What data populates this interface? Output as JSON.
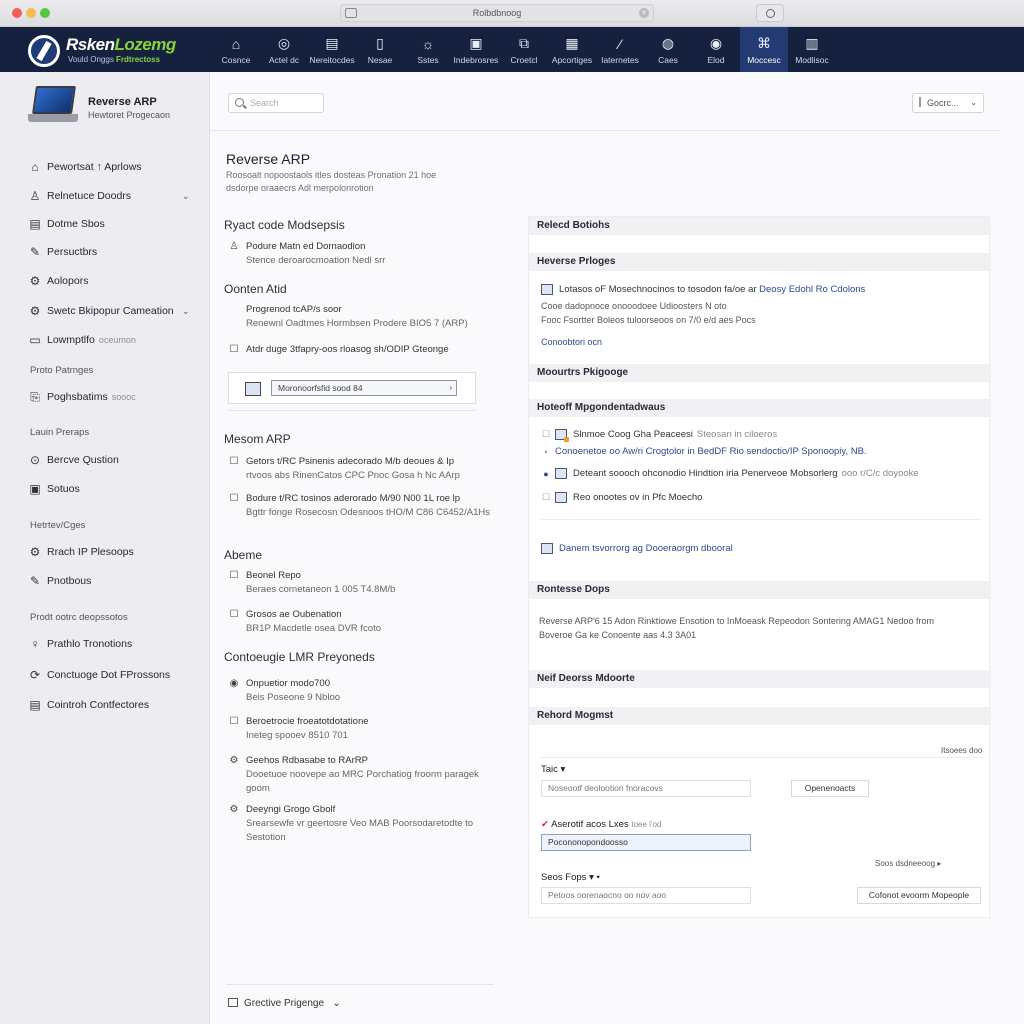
{
  "window": {
    "url": "Rolbdbnoog"
  },
  "brand": {
    "name_main": "Rsken",
    "name_accent": "Lozemg",
    "tagline_main": "Vould Onggs",
    "tagline_accent": "Frdtrectoss"
  },
  "nav": {
    "items": [
      {
        "label": "Cosnce",
        "icon": "⌂"
      },
      {
        "label": "Actel dc",
        "icon": "◎"
      },
      {
        "label": "Nereitocdes",
        "icon": "▤"
      },
      {
        "label": "Nesae",
        "icon": "▯"
      },
      {
        "label": "Sstes",
        "icon": "☼"
      },
      {
        "label": "Indebrosres",
        "icon": "▣"
      },
      {
        "label": "Croetcl",
        "icon": "⧉"
      },
      {
        "label": "Apcortiges",
        "icon": "▦"
      },
      {
        "label": "Iaternetes",
        "icon": "⁄"
      },
      {
        "label": "Caes",
        "icon": "◍"
      },
      {
        "label": "Elod",
        "icon": "◉"
      },
      {
        "label": "Moccesc",
        "icon": "⌘"
      },
      {
        "label": "Modlisoc",
        "icon": "▥"
      }
    ],
    "active_index": 11
  },
  "sidebar": {
    "product_title": "Reverse ARP",
    "product_subtitle": "Hewtoret Progecaon",
    "items": [
      {
        "label": "Pewortsat ↑ Aprlows",
        "icon": "⌂",
        "chevron": false
      },
      {
        "label": "Relnetuce Doodrs",
        "icon": "♙",
        "chevron": true
      },
      {
        "label": "Dotme Sbos",
        "icon": "▤",
        "chevron": false
      },
      {
        "label": "Persuctbrs",
        "icon": "✎",
        "chevron": false
      },
      {
        "label": "Aolopors",
        "icon": "⚙",
        "chevron": false
      },
      {
        "label": "Swetc Bkipopur Cameation",
        "icon": "⚙",
        "chevron": true
      },
      {
        "label": "Lowmptlfo",
        "icon": "▭",
        "chevron": false,
        "muted": "oceumon"
      }
    ],
    "head1": "Proto Patrnges",
    "item_after_head1": {
      "label": "Poghsbatims",
      "icon": "⎘",
      "muted": "soooc"
    },
    "head2": "Lauin Preraps",
    "group2": [
      {
        "label": "Bercve Qustion",
        "icon": "⊙"
      },
      {
        "label": "Sotuos",
        "icon": "▣"
      }
    ],
    "head3": "Hetrtev/Cges",
    "group3": [
      {
        "label": "Rrach IP Plesoops",
        "icon": "⚙"
      },
      {
        "label": "Pnotbous",
        "icon": "✎"
      }
    ],
    "head4": "Prodt ootrc deopssotos",
    "group4": [
      {
        "label": "Prathlo Tronotions",
        "icon": "♀"
      },
      {
        "label": "Conctuoge Dot FProssons",
        "icon": "⟳"
      },
      {
        "label": "Cointroh Contfectores",
        "icon": "▤"
      }
    ]
  },
  "main": {
    "search_placeholder": "Search",
    "select_value": "Gocrc...",
    "title": "Reverse ARP",
    "description": "Roosoalt nopoostaols itles dosteas Pronation 21 hoe dsdorpe oraaecrs Adl merpolonrotion",
    "sec1_title": "Ryact code Modsepsis",
    "sec1_rows": [
      {
        "line1": "Podure Matn ed Dornaodion",
        "line2": "Stence deroarocmoation Nedl srr"
      }
    ],
    "sec2_title": "Oonten Atid",
    "sec2_rows": [
      {
        "line1": "Progrenod tcAP/s soor",
        "line2": "Renewnl Oadtmes Hormbsen Prodere BIO5 7 (ARP)"
      },
      {
        "line1": "Atdr duge 3tfapry-oos rloasog sh/ODIP Gteonge",
        "line2": ""
      }
    ],
    "input_value": "Moronoorfsfid sood 84",
    "sec3_title": "Mesom ARP",
    "sec3_rows": [
      {
        "line1": "Getors t/RC Psinenis adecorado M/b deoues & Ip",
        "line2": "rtvoos abs RinenCatos CPC Pnoc Gosa h Nc AArp"
      },
      {
        "line1": "Bodure t/RC tosinos aderorado M/90 N00 1L roe lp",
        "line2": "Bgttr fonge Rosecosn Odesnoos tHO/M C86 C6452/A1Hs"
      }
    ],
    "sec4_title": "Abeme",
    "sec4_rows": [
      {
        "line1": "Beonel Repo",
        "line2": "Beraes cornetaneon 1 005 T4.8M/b"
      },
      {
        "line1": "Grosos ae Oubenation",
        "line2": "BR1P Macdetle osea DVR fcoto"
      }
    ],
    "sec5_title": "Contoeugie LMR Preyoneds",
    "sec5_rows": [
      {
        "line1": "Onpuetior modo700",
        "line2": "Beis Poseone 9 Nbloo"
      },
      {
        "line1": "Beroetrocie froeatotdotatione",
        "line2": "Ineteg spooev 8510 701"
      },
      {
        "line1": "Geehos Rdbasabe to RArRP",
        "line2": "Dooetuoe noovepe ao MRC Porchatiog froorm paragek",
        "line3": "goom"
      },
      {
        "line1": "Deeyngi Grogo Gbolf",
        "line2": "Srearsewfe vr geertosre Veo MAB Poorsodaretodte to",
        "line3": "Sestotion"
      }
    ],
    "bottom_item": "Grective Prigenge"
  },
  "rpanel": {
    "h1": "Relecd Botiohs",
    "h2": "Heverse Prloges",
    "h2_line1_a": "Lotasos oF Mosechnocinos to tosodon fa/oe ar",
    "h2_line1_b": "Deosy Edohl Ro Cdolons",
    "h2_line2": "Cooe dadopnoce onooodoee Udioosters N oto",
    "h2_line3": "Fooc Fsortter Boleos tuloorseoos on 7/0 e/d aes Pocs",
    "h2_link": "Conoobtori ocn",
    "h3": "Moourtrs Pkigooge",
    "h4": "Hoteoff Mpgondentadwaus",
    "h4_rows": [
      {
        "label": "Slnmoe Coog Gha Peaceesi",
        "muted": "Steosan in ciloeros"
      },
      {
        "label": "Conoenetoe oo Aw/ri Crogtolor in BedDF Rio sendoctio/IP Sponoopiy, NB."
      },
      {
        "label": "Deteant soooch ohconodio Hindtion iria Penerveoe Mobsorlerg",
        "muted": "ooo r/C/c doyooke"
      },
      {
        "label": "Reo onootes ov in Pfc Moecho"
      }
    ],
    "h4_link": "Danem tsvorrorg ag Dooeraorgm dbooral",
    "h5": "Rontesse Dops",
    "h5_line1": "Reverse ARP'6 15 Adon Rinktiowe Ensotion to InMoeask Repeodon Sontering AMAG1 Nedoo from",
    "h5_line2": "Boveroe Ga ke Conoente aas 4.3 3A01",
    "h6": "Neif Deorss Mdoorte",
    "h7": "Rehord Mogmst",
    "r_small1": "Itsoees doo",
    "tab_label": "Taic",
    "field1": "Noseootf deolootion fnoracovs",
    "btn1": "Openenoacts",
    "check_label": "Aserotif acos Lxes",
    "check_muted": "toee i'od",
    "field2": "Pocononopondoosso",
    "r_small2": "Soos dsdneeoog ▸",
    "tab2_label": "Seos Fops",
    "field3": "Petoos oorenaocno oo nov aoo",
    "btn2": "Cofonot evoorm Mopeople"
  }
}
